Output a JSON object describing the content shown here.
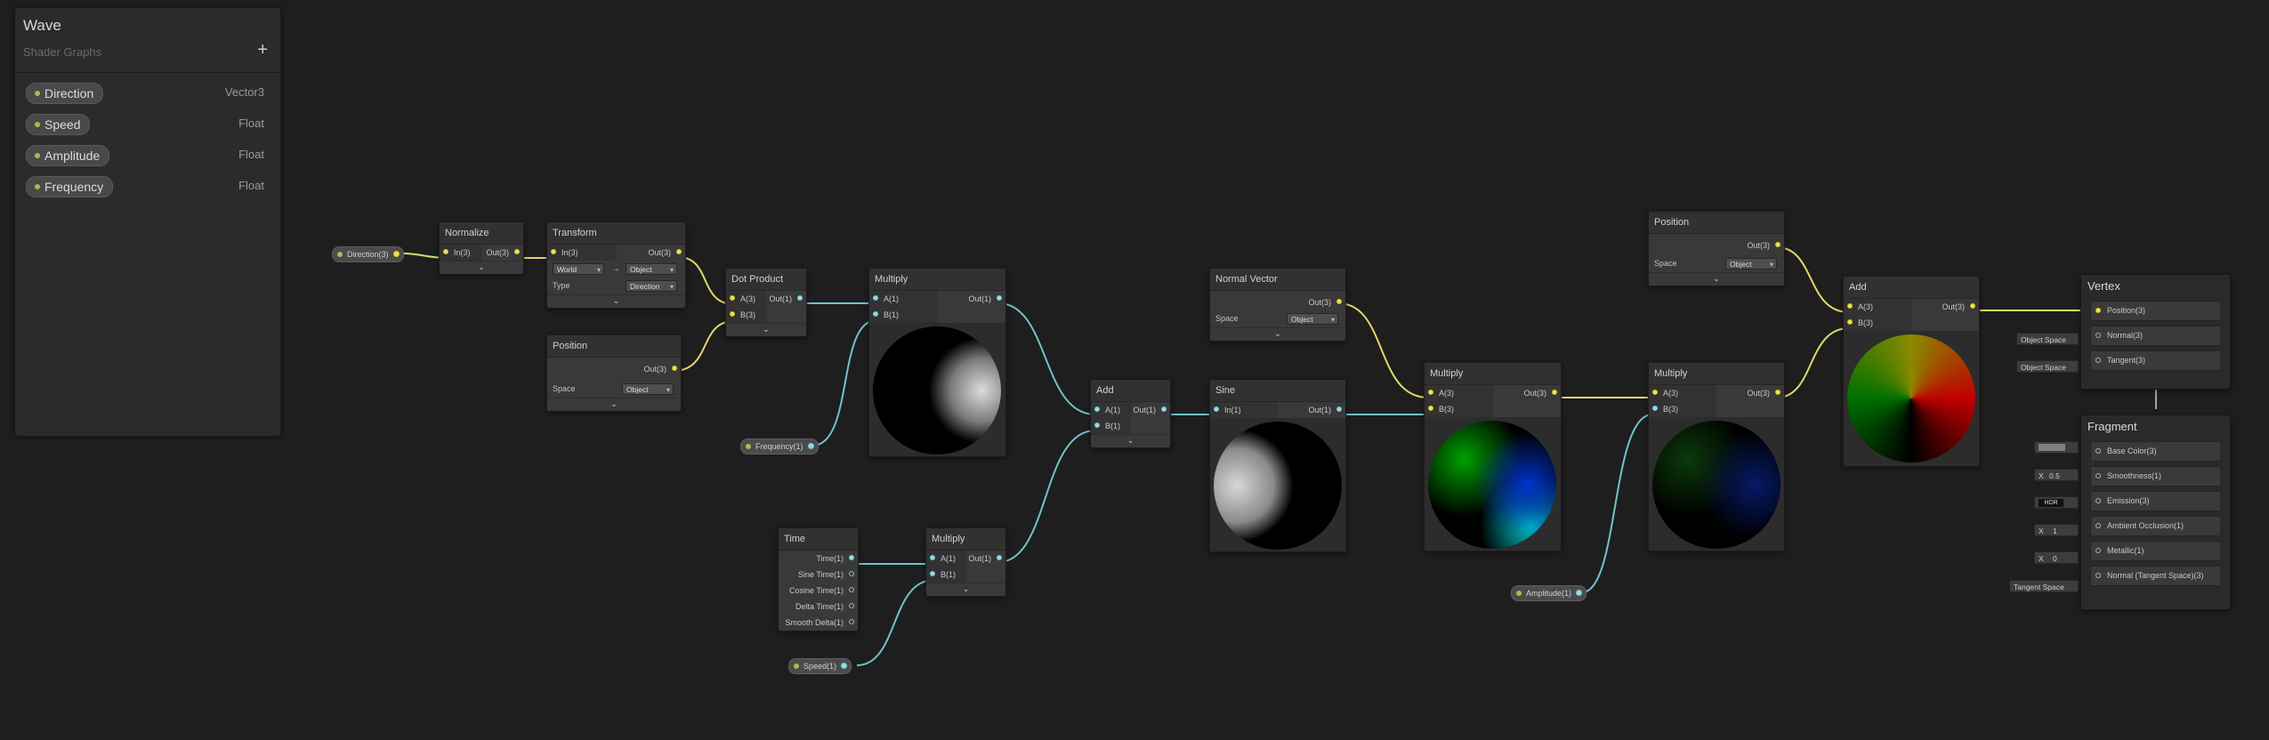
{
  "blackboard": {
    "title": "Wave",
    "subtitle": "Shader Graphs",
    "add_button": "+",
    "properties": [
      {
        "name": "Direction",
        "type": "Vector3"
      },
      {
        "name": "Speed",
        "type": "Float"
      },
      {
        "name": "Amplitude",
        "type": "Float"
      },
      {
        "name": "Frequency",
        "type": "Float"
      }
    ]
  },
  "property_nodes": {
    "direction": "Direction(3)",
    "frequency": "Frequency(1)",
    "speed": "Speed(1)",
    "amplitude": "Amplitude(1)"
  },
  "nodes": {
    "normalize": {
      "title": "Normalize",
      "in": "In(3)",
      "out": "Out(3)"
    },
    "transform": {
      "title": "Transform",
      "in": "In(3)",
      "out": "Out(3)",
      "from": "World",
      "arrow": "→",
      "to": "Object",
      "type_label": "Type",
      "type_value": "Direction"
    },
    "position1": {
      "title": "Position",
      "out": "Out(3)",
      "space_label": "Space",
      "space_value": "Object"
    },
    "dot": {
      "title": "Dot Product",
      "a": "A(3)",
      "b": "B(3)",
      "out": "Out(1)"
    },
    "multiply1": {
      "title": "Multiply",
      "a": "A(1)",
      "b": "B(1)",
      "out": "Out(1)"
    },
    "time": {
      "title": "Time",
      "outputs": [
        "Time(1)",
        "Sine Time(1)",
        "Cosine Time(1)",
        "Delta Time(1)",
        "Smooth Delta(1)"
      ]
    },
    "multiply2": {
      "title": "Multiply",
      "a": "A(1)",
      "b": "B(1)",
      "out": "Out(1)"
    },
    "add1": {
      "title": "Add",
      "a": "A(1)",
      "b": "B(1)",
      "out": "Out(1)"
    },
    "normal_vector": {
      "title": "Normal Vector",
      "out": "Out(3)",
      "space_label": "Space",
      "space_value": "Object"
    },
    "sine": {
      "title": "Sine",
      "in": "In(1)",
      "out": "Out(1)"
    },
    "multiply3": {
      "title": "Multiply",
      "a": "A(3)",
      "b": "B(3)",
      "out": "Out(3)"
    },
    "position2": {
      "title": "Position",
      "out": "Out(3)",
      "space_label": "Space",
      "space_value": "Object"
    },
    "multiply4": {
      "title": "Multiply",
      "a": "A(3)",
      "b": "B(3)",
      "out": "Out(3)"
    },
    "add2": {
      "title": "Add",
      "a": "A(3)",
      "b": "B(3)",
      "out": "Out(3)"
    }
  },
  "vertex": {
    "title": "Vertex",
    "slots": [
      "Position(3)",
      "Normal(3)",
      "Tangent(3)"
    ],
    "normal_input": "Object Space",
    "tangent_input": "Object Space"
  },
  "fragment": {
    "title": "Fragment",
    "slots": [
      "Base Color(3)",
      "Smoothness(1)",
      "Emission(3)",
      "Ambient Occlusion(1)",
      "Metallic(1)",
      "Normal (Tangent Space)(3)"
    ],
    "smoothness_x": "X",
    "smoothness_value": "0.5",
    "emission_hdr": "HDR",
    "ao_x": "X",
    "ao_value": "1",
    "metallic_x": "X",
    "metallic_value": "0",
    "normal_input": "Tangent Space"
  },
  "colors": {
    "vector3_port": "#f2e44c",
    "vector1_port": "#8fe0e8",
    "property_dot": "#9ac254",
    "background": "#1e1e1e"
  }
}
